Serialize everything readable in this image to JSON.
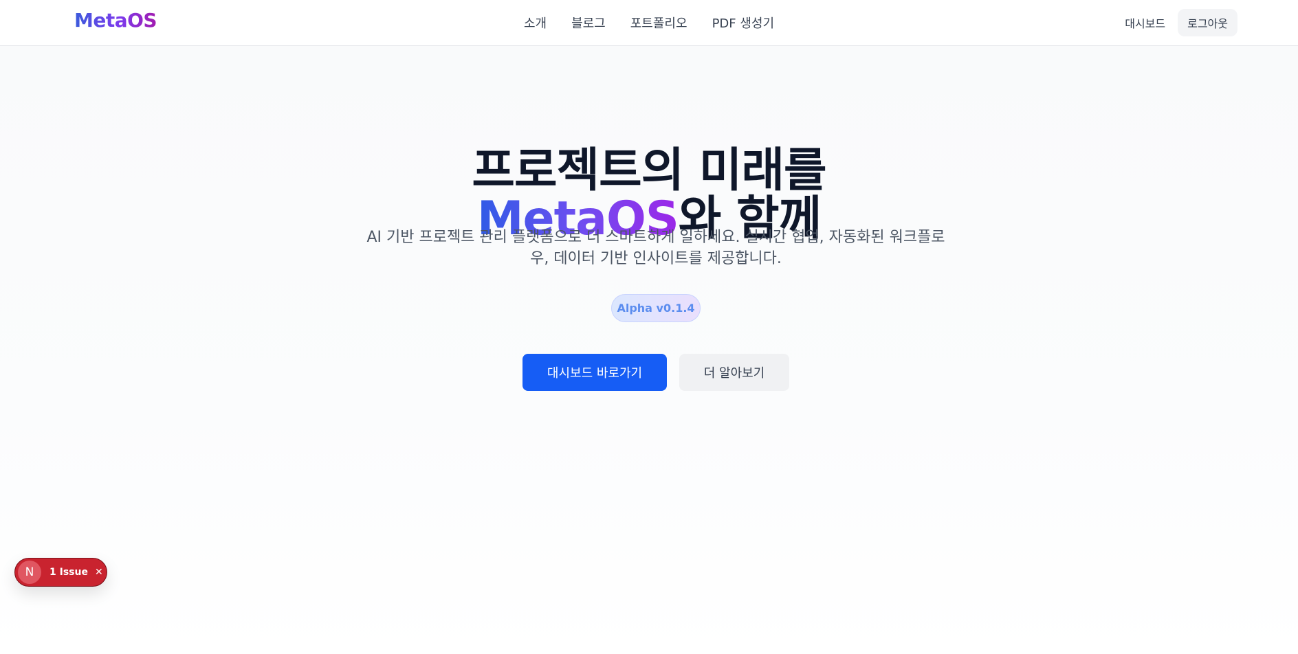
{
  "header": {
    "logo": "MetaOS",
    "nav": [
      "소개",
      "블로그",
      "포트폴리오",
      "PDF 생성기"
    ],
    "dashboard_link": "대시보드",
    "logout_label": "로그아웃"
  },
  "hero": {
    "title_line1": "프로젝트의 미래를",
    "title_brand": "MetaOS",
    "title_line2_rest": "와 함께",
    "subtitle": "AI 기반 프로젝트 관리 플랫폼으로 더 스마트하게 일하세요. 실시간 협업, 자동화된 워크플로우, 데이터 기반 인사이트를 제공합니다.",
    "badge": "Alpha v0.1.4",
    "primary_button": "대시보드 바로가기",
    "secondary_button": "더 알아보기"
  },
  "issue_indicator": {
    "icon_letter": "N",
    "label": "1 Issue",
    "close_glyph": "✕"
  },
  "colors": {
    "primary": "#165df5",
    "issue_red": "#c9232f",
    "brand_gradient_start": "#2f5be6",
    "brand_gradient_end": "#9c27e8"
  }
}
